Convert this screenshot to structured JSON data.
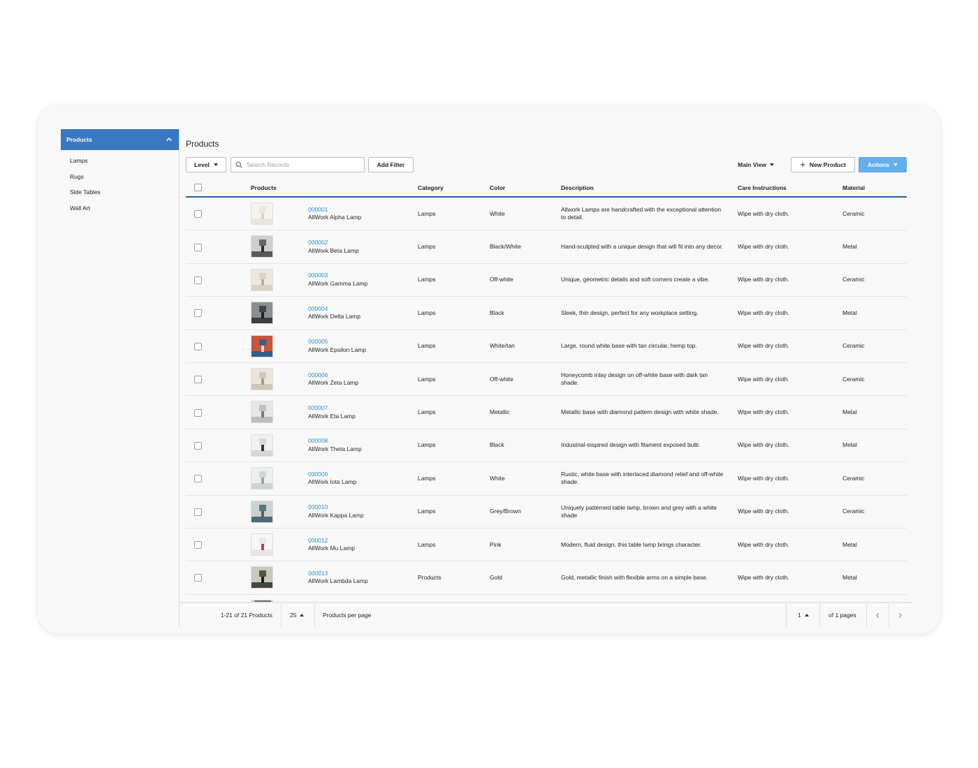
{
  "sidebar": {
    "header": "Products",
    "items": [
      "Lamps",
      "Rugs",
      "Side Tables",
      "Wall Art"
    ]
  },
  "page_title": "Products",
  "toolbar": {
    "level_label": "Level",
    "search_placeholder": "Search Records",
    "add_filter_label": "Add Filter",
    "main_view_label": "Main View",
    "new_product_label": "New Product",
    "actions_label": "Actions"
  },
  "colors": {
    "accent": "#3a78c2",
    "link": "#2a90c9",
    "actions_button": "#62afe9"
  },
  "table": {
    "headers": {
      "products": "Products",
      "category": "Category",
      "color": "Color",
      "description": "Description",
      "care": "Care Instructions",
      "material": "Material"
    },
    "rows": [
      {
        "id": "000001",
        "name": "AllWork Alpha Lamp",
        "category": "Lamps",
        "color": "White",
        "description": "Allwork Lamps are handcrafted with the exceptional attention to detail.",
        "care": "Wipe with dry cloth.",
        "material": "Ceramic"
      },
      {
        "id": "000002",
        "name": "AllWork Beta Lamp",
        "category": "Lamps",
        "color": "Black/White",
        "description": "Hand-sculpted with a unique design that will fit into any decor.",
        "care": "Wipe with dry cloth.",
        "material": "Metal"
      },
      {
        "id": "000003",
        "name": "AllWork Gamma Lamp",
        "category": "Lamps",
        "color": "Off-white",
        "description": "Unique, geometric details and soft corners create a vibe.",
        "care": "Wipe with dry cloth.",
        "material": "Ceramic"
      },
      {
        "id": "000004",
        "name": "AllWork Delta Lamp",
        "category": "Lamps",
        "color": "Black",
        "description": "Sleek, thin design, perfect for any workplace setting.",
        "care": "Wipe with dry cloth.",
        "material": "Metal"
      },
      {
        "id": "000005",
        "name": "AllWork Epsilon Lamp",
        "category": "Lamps",
        "color": "White/tan",
        "description": "Large, round white base with tan circular, hemp top.",
        "care": "Wipe with dry cloth.",
        "material": "Ceramic"
      },
      {
        "id": "000006",
        "name": "AllWork Zeta Lamp",
        "category": "Lamps",
        "color": "Off-white",
        "description": "Honeycomb inlay design on off-white base with dark tan shade.",
        "care": "Wipe with dry cloth.",
        "material": "Ceramic"
      },
      {
        "id": "000007",
        "name": "AllWork Eta Lamp",
        "category": "Lamps",
        "color": "Metallic",
        "description": "Metallic base with diamond pattern design with white shade.",
        "care": "Wipe with dry cloth.",
        "material": "Metal"
      },
      {
        "id": "000008",
        "name": "AllWork Theta Lamp",
        "category": "Lamps",
        "color": "Black",
        "description": "Industrial-inspired design with filament exposed bulb.",
        "care": "Wipe with dry cloth.",
        "material": "Metal"
      },
      {
        "id": "000009",
        "name": "AllWork Iota Lamp",
        "category": "Lamps",
        "color": "White",
        "description": "Rustic, white base with interlaced diamond relief and off-white shade.",
        "care": "Wipe with dry cloth.",
        "material": "Ceramic"
      },
      {
        "id": "000010",
        "name": "AllWork Kappa Lamp",
        "category": "Lamps",
        "color": "Grey/Brown",
        "description": "Uniquely patterned table lamp, brown and grey with a white shade",
        "care": "Wipe with dry cloth.",
        "material": "Ceramic"
      },
      {
        "id": "000012",
        "name": "AllWork Mu Lamp",
        "category": "Lamps",
        "color": "Pink",
        "description": "Modern, fluid design, this table lamp brings character.",
        "care": "Wipe with dry cloth.",
        "material": "Metal"
      },
      {
        "id": "000013",
        "name": "AllWork Lambda Lamp",
        "category": "Products",
        "color": "Gold",
        "description": "Gold, metallic finish with flexible arms on a simple base.",
        "care": "Wipe with dry cloth.",
        "material": "Metal"
      }
    ]
  },
  "footer": {
    "range": "1-21 of 21 Products",
    "per_page": "25",
    "per_page_label": "Products per page",
    "page": "1",
    "of_pages": "of 1 pages"
  }
}
